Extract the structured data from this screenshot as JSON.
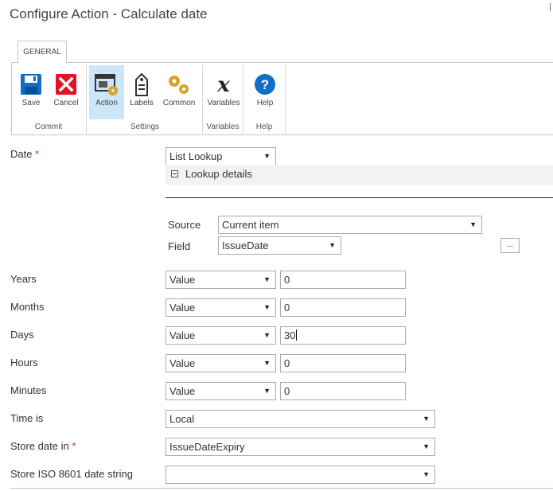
{
  "window": {
    "title": "Configure Action - Calculate date"
  },
  "ribbon": {
    "tab_label": "GENERAL",
    "buttons": {
      "save": "Save",
      "cancel": "Cancel",
      "action": "Action",
      "labels": "Labels",
      "common": "Common",
      "variables": "Variables",
      "help": "Help"
    },
    "groups": {
      "commit": "Commit",
      "settings": "Settings",
      "variables": "Variables",
      "help": "Help"
    },
    "icons": {
      "save": "save-disk-icon",
      "cancel": "cancel-x-icon",
      "action": "action-window-gear-icon",
      "labels": "label-tag-icon",
      "common": "gears-icon",
      "variables": "variable-x-icon",
      "help": "help-question-icon"
    },
    "active_button": "Action"
  },
  "form": {
    "date": {
      "label": "Date",
      "required_mark": "*",
      "value": "List Lookup",
      "lookup_details_label": "Lookup details",
      "source_label": "Source",
      "source_value": "Current item",
      "field_label": "Field",
      "field_value": "IssueDate",
      "browse_button": "..."
    },
    "years": {
      "label": "Years",
      "type": "Value",
      "value": "0"
    },
    "months": {
      "label": "Months",
      "type": "Value",
      "value": "0"
    },
    "days": {
      "label": "Days",
      "type": "Value",
      "value": "30"
    },
    "hours": {
      "label": "Hours",
      "type": "Value",
      "value": "0"
    },
    "minutes": {
      "label": "Minutes",
      "type": "Value",
      "value": "0"
    },
    "time_is": {
      "label": "Time is",
      "value": "Local"
    },
    "store_date_in": {
      "label": "Store date in",
      "required_mark": "*",
      "value": "IssueDateExpiry"
    },
    "store_iso": {
      "label": "Store ISO 8601 date string",
      "value": ""
    }
  },
  "colors": {
    "accent_blue": "#0f6fc6",
    "cancel_red": "#e81123",
    "gear_gold": "#d9a320",
    "active_highlight": "#cde6f7",
    "required_red": "#c0392b"
  }
}
